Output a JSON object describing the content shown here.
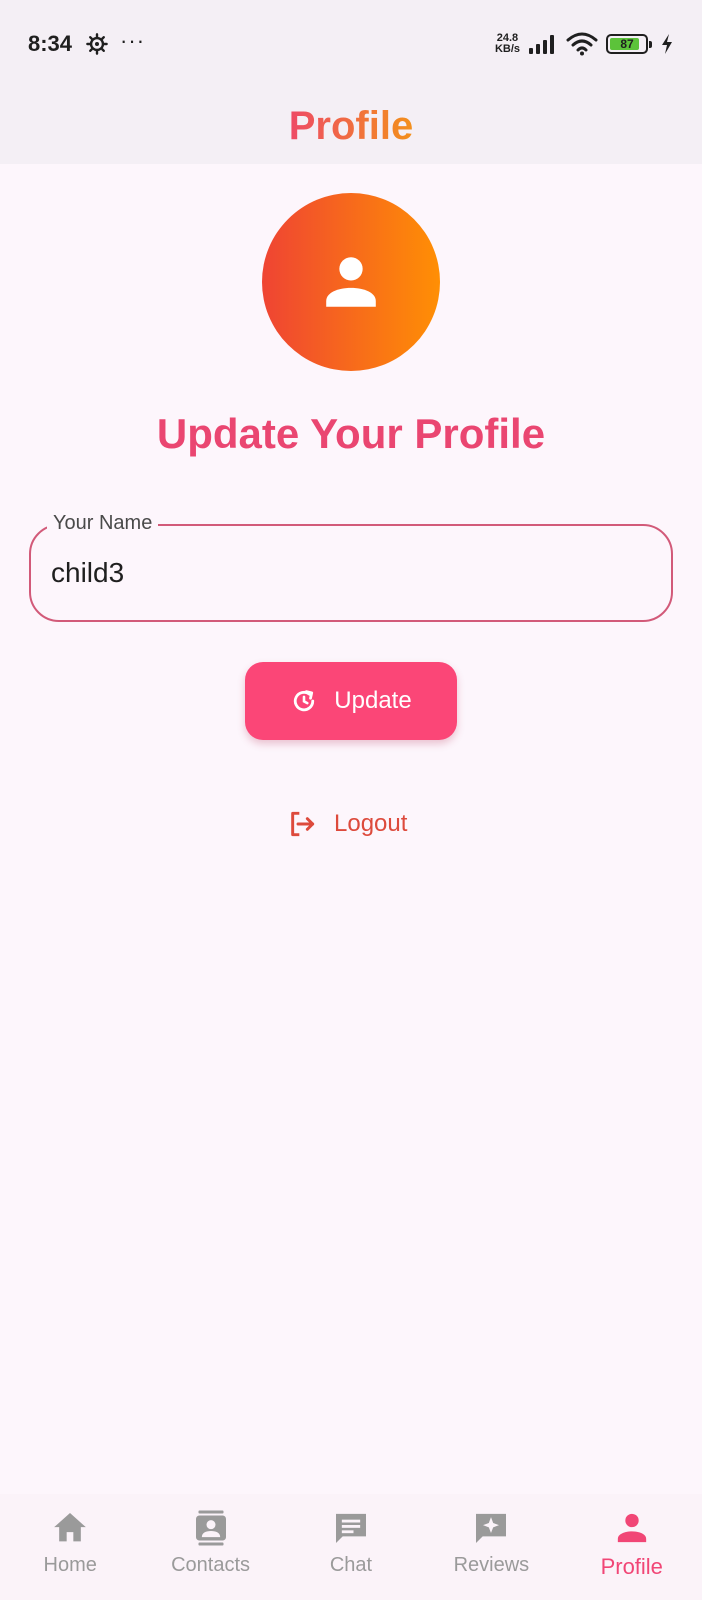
{
  "status_bar": {
    "time": "8:34",
    "extra": "···",
    "net_speed_value": "24.8",
    "net_speed_unit": "KB/s",
    "battery_level": 87,
    "battery_text": "87"
  },
  "app_bar": {
    "title": "Profile"
  },
  "main": {
    "heading": "Update Your Profile",
    "name_field": {
      "label": "Your Name",
      "value": "child3"
    },
    "update_button": {
      "label": "Update",
      "icon": "refresh-icon"
    },
    "logout": {
      "label": "Logout",
      "icon": "logout-icon"
    }
  },
  "bottom_nav": {
    "items": [
      {
        "label": "Home",
        "icon": "home-icon",
        "active": false
      },
      {
        "label": "Contacts",
        "icon": "contacts-icon",
        "active": false
      },
      {
        "label": "Chat",
        "icon": "chat-icon",
        "active": false
      },
      {
        "label": "Reviews",
        "icon": "reviews-icon",
        "active": false
      },
      {
        "label": "Profile",
        "icon": "person-icon",
        "active": true
      }
    ]
  },
  "colors": {
    "accent": "#fb4677",
    "heading": "#ea4671",
    "avatar_gradient": [
      "#ef4433",
      "#ff8f04"
    ],
    "logout": "#dd4a3c",
    "nav_inactive": "#9a9a9a"
  }
}
